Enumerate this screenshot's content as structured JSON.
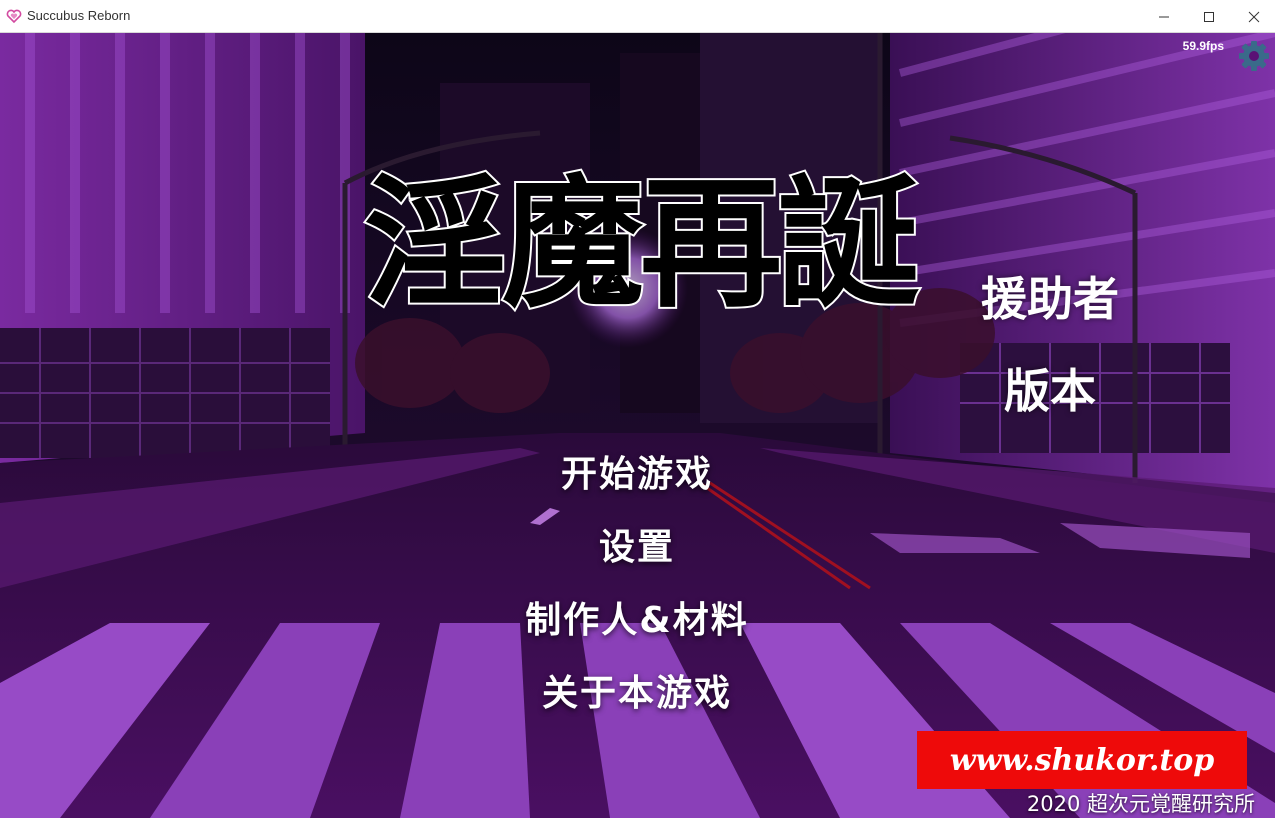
{
  "window": {
    "title": "Succubus Reborn",
    "controls": [
      "minimize",
      "maximize",
      "close"
    ]
  },
  "hud": {
    "fps": "59.9fps",
    "settings_icon": "gear-icon"
  },
  "logo": {
    "title": "淫魔再誕"
  },
  "edition": {
    "line1": "援助者",
    "line2": "版本"
  },
  "menu": {
    "items": [
      {
        "label": "开始游戏"
      },
      {
        "label": "设置"
      },
      {
        "label": "制作人&材料"
      },
      {
        "label": "关于本游戏"
      }
    ]
  },
  "watermark": {
    "text": "www.shukor.top"
  },
  "footer": {
    "copyright": "2020 超次元覚醒研究所"
  },
  "colors": {
    "background_purple": "#5a1075",
    "watermark_red": "#ee0a0a",
    "gear_blue": "#3a6a8a"
  }
}
